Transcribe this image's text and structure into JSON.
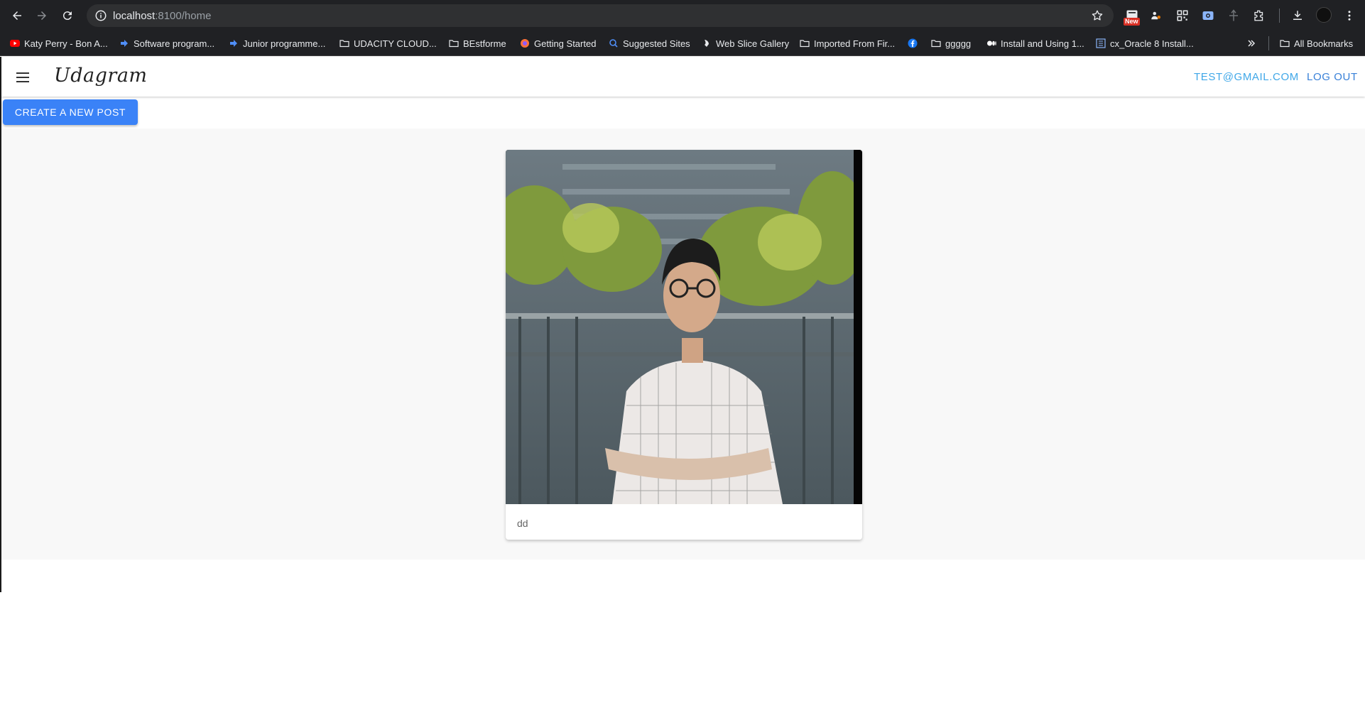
{
  "browser": {
    "url_host": "localhost",
    "url_path": ":8100/home",
    "ext_badge": "New",
    "bookmarks": [
      {
        "label": "Katy Perry - Bon A...",
        "icon": "youtube-icon"
      },
      {
        "label": "Software program...",
        "icon": "arrow-icon"
      },
      {
        "label": "Junior programme...",
        "icon": "arrow-icon"
      },
      {
        "label": "UDACITY CLOUD...",
        "icon": "folder-icon"
      },
      {
        "label": "BEstforme",
        "icon": "folder-icon"
      },
      {
        "label": "Getting Started",
        "icon": "firefox-icon"
      },
      {
        "label": "Suggested Sites",
        "icon": "search-icon"
      },
      {
        "label": "Web Slice Gallery",
        "icon": "slice-icon"
      },
      {
        "label": "Imported From Fir...",
        "icon": "folder-icon"
      },
      {
        "label": "",
        "icon": "facebook-icon"
      },
      {
        "label": "ggggg",
        "icon": "folder-icon"
      },
      {
        "label": "Install and Using 1...",
        "icon": "medium-icon"
      },
      {
        "label": "cx_Oracle 8 Install...",
        "icon": "doc-icon"
      }
    ],
    "all_bookmarks": "All Bookmarks"
  },
  "app": {
    "brand": "Udagram",
    "user_email": "TEST@GMAIL.COM",
    "logout_label": "LOG OUT",
    "create_post_label": "CREATE A NEW POST"
  },
  "feed": {
    "items": [
      {
        "caption": "dd",
        "image": "portrait photo of a man with glasses in a checkered shirt, arms crossed, in front of a green building"
      }
    ]
  },
  "colors": {
    "accent": "#3a82f7",
    "email_link": "#3fa7e8",
    "logout_link": "#3880d8",
    "chrome_bg": "#202124"
  }
}
